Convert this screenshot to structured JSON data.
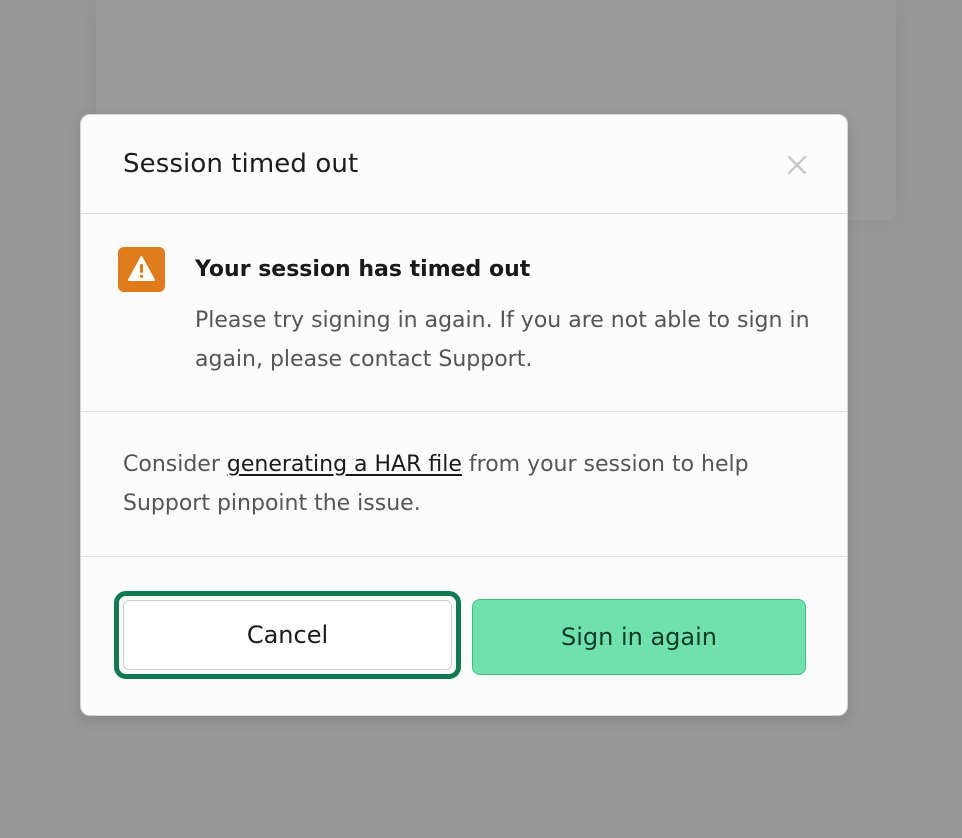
{
  "modal": {
    "title": "Session timed out",
    "close_icon": "close-icon"
  },
  "alert": {
    "icon": "warning-icon",
    "icon_color": "#e07b1b",
    "heading": "Your session has timed out",
    "body": "Please try signing in again. If you are not able to sign in again, please contact Support."
  },
  "har": {
    "prefix": "Consider ",
    "link_text": "generating a HAR file",
    "suffix": " from your session to help Support pinpoint the issue."
  },
  "actions": {
    "cancel_label": "Cancel",
    "signin_label": "Sign in again",
    "focus_ring_color": "#0f7a52",
    "primary_color": "#6fe1ad"
  }
}
